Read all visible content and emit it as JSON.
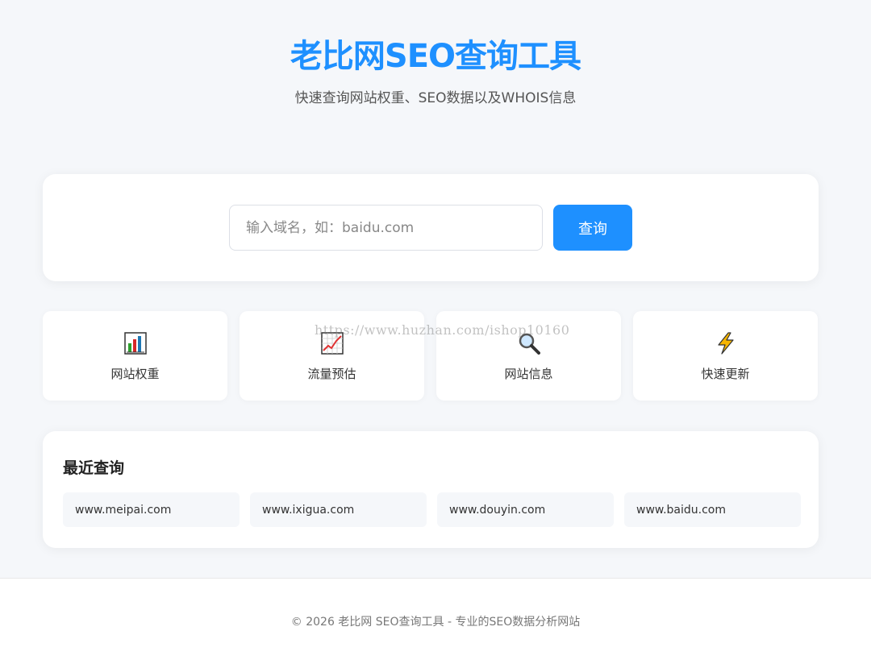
{
  "header": {
    "title": "老比网SEO查询工具",
    "subtitle": "快速查询网站权重、SEO数据以及WHOIS信息"
  },
  "search": {
    "placeholder": "输入域名，如：baidu.com",
    "value": "",
    "button_label": "查询",
    "accent_color": "#1e90ff"
  },
  "features": [
    {
      "icon": "bar-chart-icon",
      "label": "网站权重"
    },
    {
      "icon": "trend-chart-icon",
      "label": "流量预估"
    },
    {
      "icon": "magnifier-icon",
      "label": "网站信息"
    },
    {
      "icon": "lightning-icon",
      "label": "快速更新"
    }
  ],
  "recent": {
    "title": "最近查询",
    "items": [
      "www.meipai.com",
      "www.ixigua.com",
      "www.douyin.com",
      "www.baidu.com"
    ]
  },
  "footer": {
    "text": "© 2026 老比网 SEO查询工具 - 专业的SEO数据分析网站"
  },
  "watermark": "https://www.huzhan.com/ishop10160"
}
